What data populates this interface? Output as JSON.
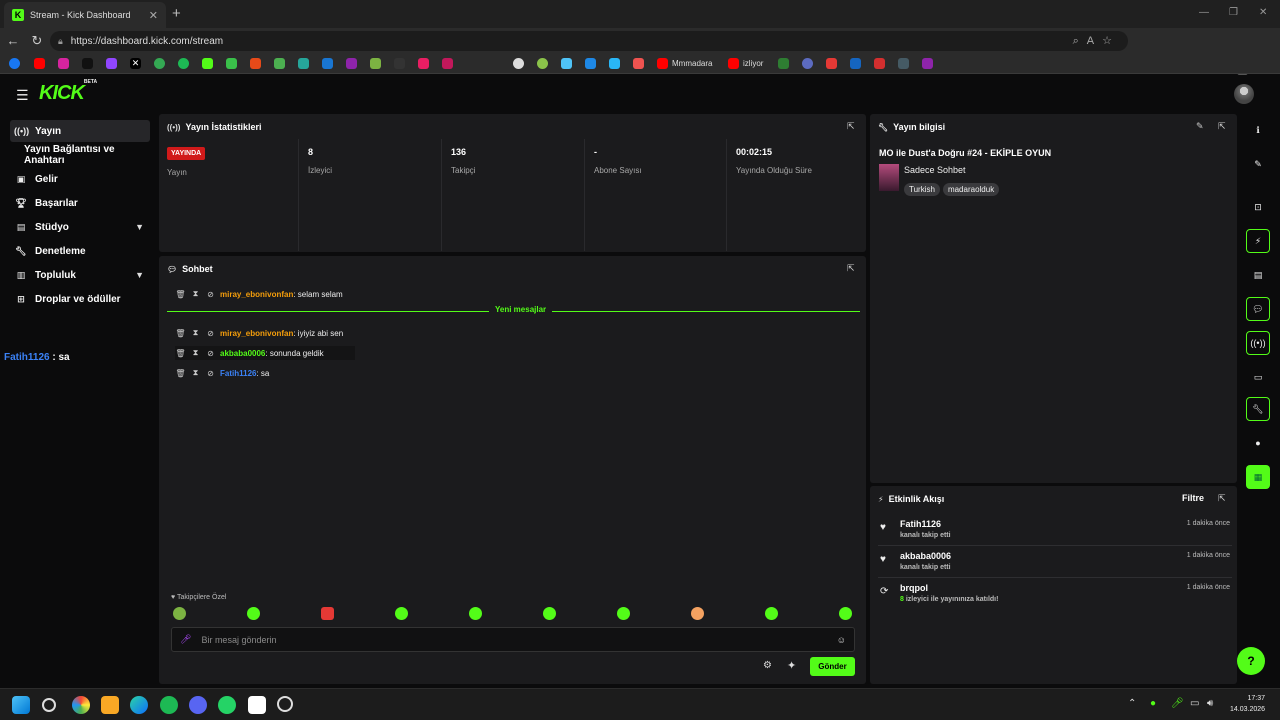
{
  "browser": {
    "tab_title": "Stream - Kick Dashboard",
    "url": "https://dashboard.kick.com/stream",
    "bookmarks": [
      {
        "label": "Mmmadara"
      },
      {
        "label": "izliyor"
      }
    ]
  },
  "header": {
    "logo": "KICK",
    "logo_badge": "BETA"
  },
  "sidebar": {
    "items": [
      {
        "label": "Yayın",
        "icon": "broadcast-icon"
      },
      {
        "label": "Yayın Bağlantısı ve Anahtarı",
        "icon": ""
      },
      {
        "label": "Gelir",
        "icon": "revenue-icon"
      },
      {
        "label": "Başarılar",
        "icon": "trophy-icon"
      },
      {
        "label": "Stüdyo",
        "icon": "studio-icon"
      },
      {
        "label": "Denetleme",
        "icon": "wrench-icon"
      },
      {
        "label": "Topluluk",
        "icon": "community-icon"
      },
      {
        "label": "Droplar ve ödüller",
        "icon": "gift-icon"
      }
    ]
  },
  "overlay_chat": {
    "user": "Fatih1126",
    "text": " : sa"
  },
  "stats": {
    "title": "Yayın İstatistikleri",
    "items": [
      {
        "value": "YAYINDA",
        "label": "Yayın"
      },
      {
        "value": "8",
        "label": "İzleyici"
      },
      {
        "value": "136",
        "label": "Takipçi"
      },
      {
        "value": "-",
        "label": "Abone Sayısı"
      },
      {
        "value": "00:02:15",
        "label": "Yayında Olduğu Süre"
      }
    ]
  },
  "chat": {
    "title": "Sohbet",
    "new_messages_label": "Yeni mesajlar",
    "messages": [
      {
        "user": "miray_ebonivonfan",
        "text": ": selam selam",
        "color": "#f59e0b"
      },
      {
        "user": "miray_ebonivonfan",
        "text": ": iyiyiz abi sen",
        "color": "#f59e0b"
      },
      {
        "user": "akbaba0006",
        "text": ": sonunda geldik",
        "color": "#53fc18"
      },
      {
        "user": "Fatih1126",
        "text": ": sa",
        "color": "#3b82f6"
      }
    ],
    "followers_only_label": "Takipçilere Özel",
    "input_placeholder": "Bir mesaj gönderin",
    "send_label": "Gönder"
  },
  "stream_info": {
    "title": "Yayın bilgisi",
    "stream_title": "MO ile Dust'a Doğru #24 - EKİPLE OYUN",
    "category": "Sadece Sohbet",
    "tags": [
      "Turkish",
      "madaraolduk"
    ]
  },
  "activity": {
    "title": "Etkinlik Akışı",
    "filter_label": "Filtre",
    "items": [
      {
        "name": "Fatih1126",
        "desc": "kanalı takip etti",
        "time": "1 dakika önce",
        "icon": "heart-icon"
      },
      {
        "name": "akbaba0006",
        "desc": "kanalı takip etti",
        "time": "1 dakika önce",
        "icon": "heart-icon"
      },
      {
        "name": "brqpol",
        "count": "8",
        "desc": " izleyici ile yayınınıza katıldı!",
        "time": "1 dakika önce",
        "icon": "raid-icon"
      }
    ]
  },
  "taskbar": {
    "time": "17:37",
    "date": "14.03.2026"
  },
  "colors": {
    "accent": "#53fc18",
    "panel": "#1b1b1d",
    "live": "#d11a1a"
  }
}
